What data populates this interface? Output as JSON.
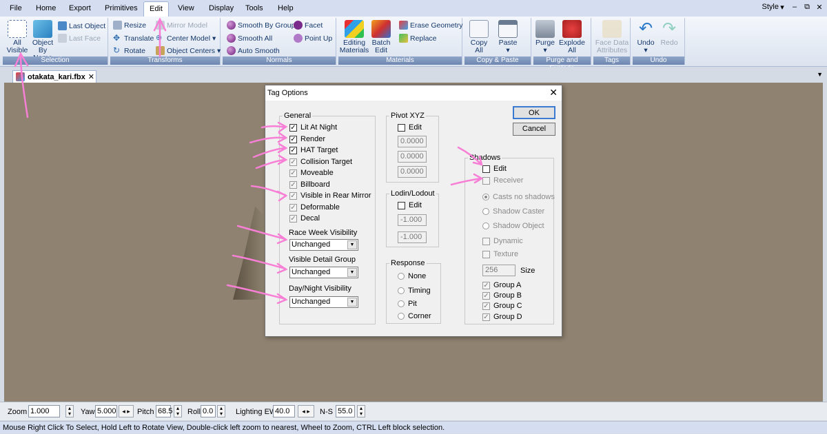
{
  "menu": [
    "File",
    "Home",
    "Export",
    "Primitives",
    "Edit",
    "View",
    "Display",
    "Tools",
    "Help"
  ],
  "active_menu": "Edit",
  "style_label": "Style",
  "window_controls": [
    "▾",
    "–",
    "⧉",
    "✕"
  ],
  "ribbon": {
    "selection": {
      "label": "Selection",
      "all_visible": "All Visible",
      "object_by_name": "Object By Name",
      "last_object": "Last Object",
      "last_face": "Last Face"
    },
    "transforms": {
      "label": "Transforms",
      "resize": "Resize",
      "translate": "Translate",
      "rotate": "Rotate",
      "mirror_model": "Mirror Model",
      "center_model": "Center Model",
      "object_centers": "Object Centers"
    },
    "normals": {
      "label": "Normals",
      "smooth_by_group": "Smooth By Group",
      "smooth_all": "Smooth All",
      "auto_smooth": "Auto Smooth",
      "facet": "Facet",
      "point_up": "Point Up"
    },
    "materials": {
      "label": "Materials",
      "editing_materials": "Editing Materials",
      "batch_edit": "Batch Edit",
      "erase_geometry": "Erase Geometry",
      "replace": "Replace"
    },
    "copy_paste": {
      "label": "Copy & Paste",
      "copy_all": "Copy All",
      "paste": "Paste"
    },
    "purge_explode": {
      "label": "Purge and Explode",
      "purge": "Purge",
      "explode_all": "Explode All"
    },
    "tags": {
      "label": "Tags",
      "face_data_attributes": "Face Data Attributes"
    },
    "undo": {
      "label": "Undo",
      "undo": "Undo",
      "redo": "Redo"
    }
  },
  "document_tab": "otakata_kari.fbx",
  "dialog": {
    "title": "Tag Options",
    "ok": "OK",
    "cancel": "Cancel",
    "general": {
      "label": "General",
      "checkboxes": [
        {
          "label": "Lit At Night",
          "checked": true,
          "enabled": true
        },
        {
          "label": "Render",
          "checked": true,
          "enabled": true
        },
        {
          "label": "HAT Target",
          "checked": true,
          "enabled": true
        },
        {
          "label": "Collision Target",
          "checked": true,
          "enabled": false
        },
        {
          "label": "Moveable",
          "checked": true,
          "enabled": false
        },
        {
          "label": "Billboard",
          "checked": true,
          "enabled": false
        },
        {
          "label": "Visible in Rear Mirror",
          "checked": true,
          "enabled": false
        },
        {
          "label": "Deformable",
          "checked": true,
          "enabled": false
        },
        {
          "label": "Decal",
          "checked": true,
          "enabled": false
        }
      ],
      "race_week_label": "Race Week Visibility",
      "race_week_value": "Unchanged",
      "detail_group_label": "Visible Detail Group",
      "detail_group_value": "Unchanged",
      "day_night_label": "Day/Night Visibility",
      "day_night_value": "Unchanged"
    },
    "pivot": {
      "label": "Pivot XYZ",
      "edit": "Edit",
      "values": [
        "0.0000",
        "0.0000",
        "0.0000"
      ]
    },
    "lodin": {
      "label": "Lodin/Lodout",
      "edit": "Edit",
      "values": [
        "-1.000",
        "-1.000"
      ]
    },
    "response": {
      "label": "Response",
      "options": [
        "None",
        "Timing",
        "Pit",
        "Corner"
      ]
    },
    "shadows": {
      "label": "Shadows",
      "edit": "Edit",
      "receiver": "Receiver",
      "radios": [
        {
          "label": "Casts no shadows",
          "selected": true
        },
        {
          "label": "Shadow Caster",
          "selected": false
        },
        {
          "label": "Shadow Object",
          "selected": false
        }
      ],
      "dynamic": "Dynamic",
      "texture": "Texture",
      "size_value": "256",
      "size_label": "Size",
      "groups": [
        "Group A",
        "Group B",
        "Group C",
        "Group D"
      ]
    }
  },
  "toolbar": {
    "zoom_label": "Zoom",
    "zoom": "1.000",
    "yaw_label": "Yaw",
    "yaw": "5.000",
    "pitch_label": "Pitch",
    "pitch": "68.5",
    "roll_label": "Roll",
    "roll": "0.0",
    "lighting_label": "Lighting EW",
    "lighting": "40.0",
    "ns_label": "N-S",
    "ns": "55.0"
  },
  "status": "Mouse Right Click To Select, Hold Left to Rotate View, Double-click left  zoom to nearest, Wheel to Zoom, CTRL Left block selection.",
  "colors": {
    "annotation_arrow": "#f77fd6",
    "viewport": "#8f8270",
    "ribbon_label": "#7a90b8"
  }
}
